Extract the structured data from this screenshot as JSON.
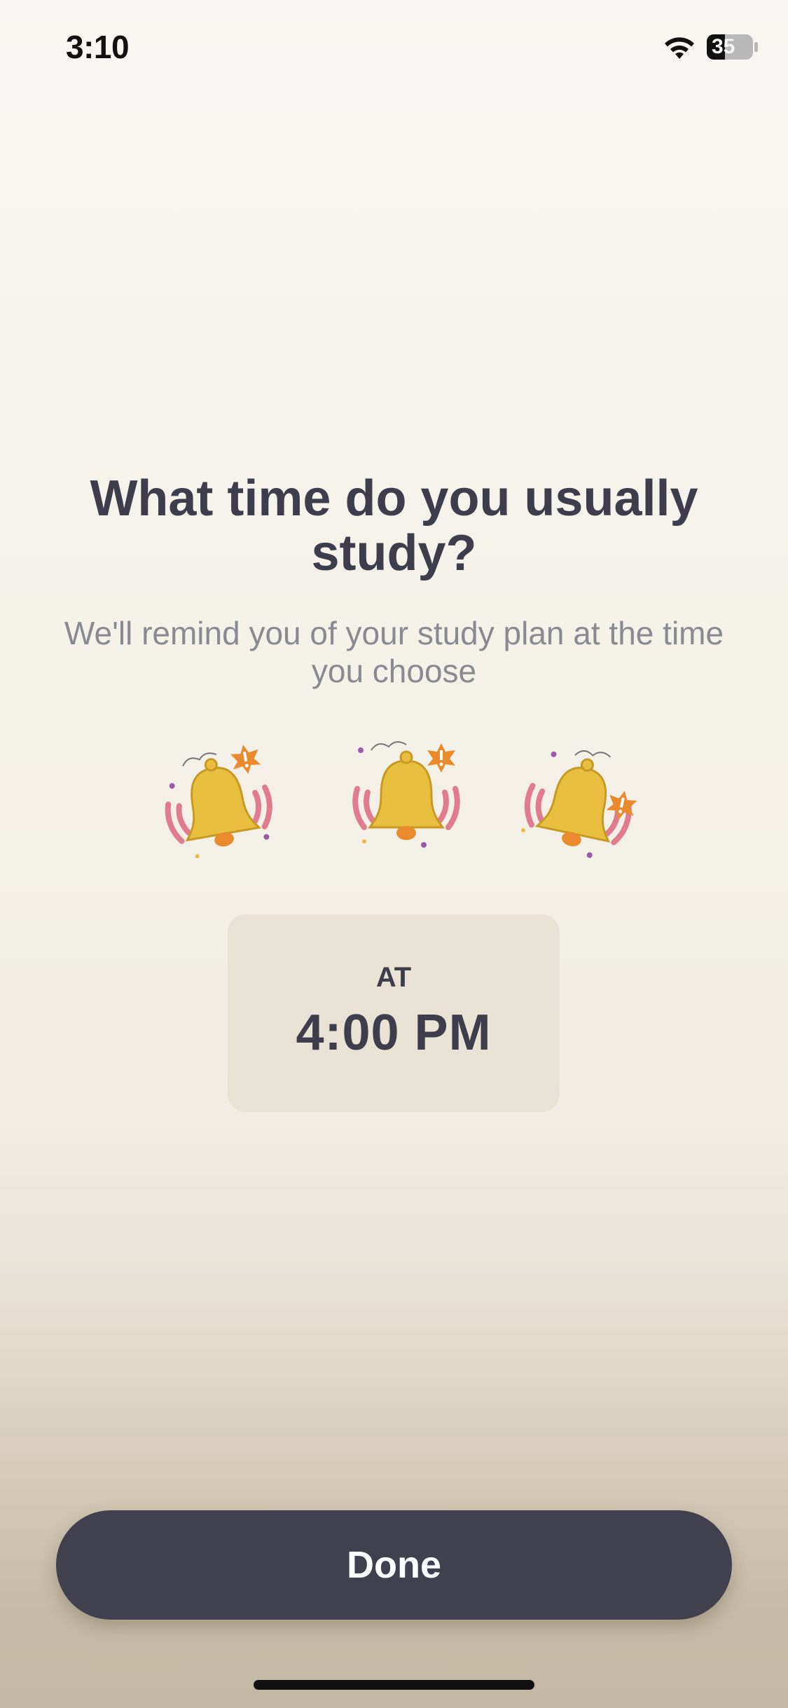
{
  "status_bar": {
    "time": "3:10",
    "battery_level": "35",
    "wifi_icon": "wifi-icon",
    "battery_icon": "battery-icon"
  },
  "main": {
    "title": "What time do you usually study?",
    "subtitle": "We'll remind you of your study plan at the time you choose",
    "illustration_icons": [
      "bell-icon",
      "bell-icon",
      "bell-icon"
    ]
  },
  "time_card": {
    "label": "AT",
    "value": "4:00 PM"
  },
  "footer": {
    "done_label": "Done"
  },
  "colors": {
    "button_bg": "#40404f",
    "card_bg": "#e9e3d5",
    "bell_yellow": "#e9bf3f",
    "accent_orange": "#e98a2c",
    "wave_pink": "#e07c8e"
  }
}
